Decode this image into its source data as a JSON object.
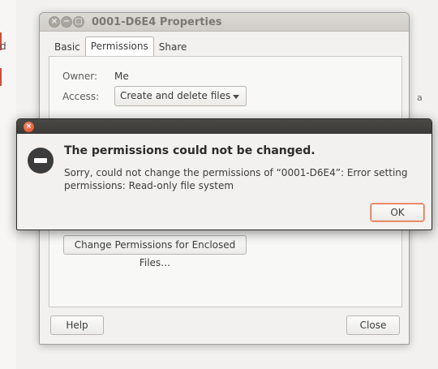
{
  "background": {
    "left_fragment": "d",
    "right_fragment": "a"
  },
  "window": {
    "title": "0001-D6E4 Properties",
    "tabs": [
      {
        "label": "Basic"
      },
      {
        "label": "Permissions",
        "active": true
      },
      {
        "label": "Share"
      }
    ],
    "owner_label": "Owner:",
    "owner_value": "Me",
    "access_label": "Access:",
    "access_value": "Create and delete files",
    "enclosed_button": "Change Permissions for Enclosed Files…",
    "help_button": "Help",
    "close_button": "Close"
  },
  "dialog": {
    "heading": "The permissions could not be changed.",
    "message": "Sorry, could not change the permissions of “0001-D6E4”: Error setting permissions: Read-only file system",
    "ok_button": "OK",
    "accent_color": "#df4b21"
  }
}
